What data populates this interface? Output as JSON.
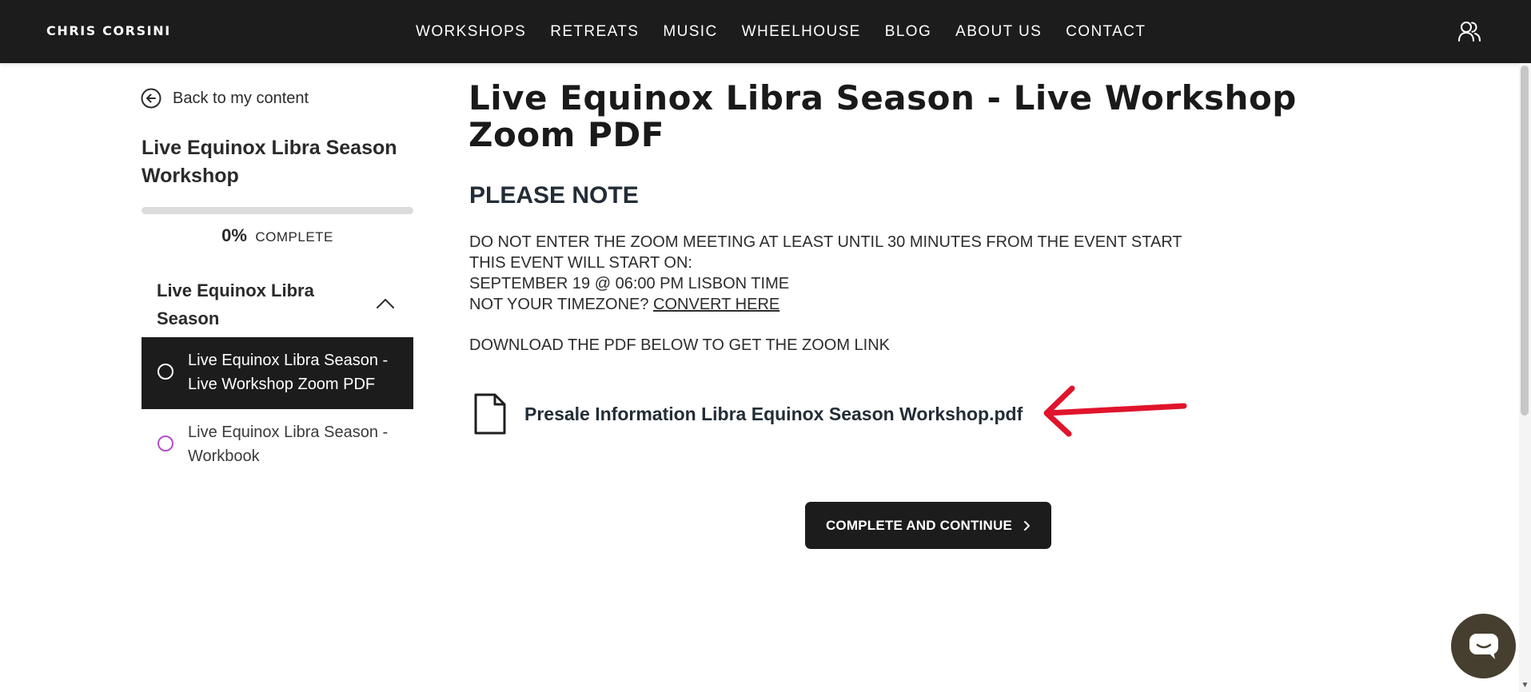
{
  "header": {
    "brand": "CHRIS CORSINI",
    "nav": [
      "WORKSHOPS",
      "RETREATS",
      "MUSIC",
      "WHEELHOUSE",
      "BLOG",
      "ABOUT US",
      "CONTACT"
    ],
    "account_icon": "user-group-icon"
  },
  "sidebar": {
    "back_label": "Back to my content",
    "course_title": "Live Equinox Libra Season Workshop",
    "progress": {
      "percent": 0,
      "percent_label": "0%",
      "label": "COMPLETE"
    },
    "section": {
      "title": "Live Equinox Libra Season",
      "expanded": true
    },
    "lessons": [
      {
        "label": "Live Equinox Libra Season - Live Workshop Zoom PDF",
        "active": true
      },
      {
        "label": "Live Equinox Libra Season - Workbook",
        "active": false
      }
    ]
  },
  "main": {
    "title": "Live Equinox Libra Season - Live Workshop Zoom PDF",
    "note_heading": "PLEASE NOTE",
    "note_lines": [
      "DO NOT ENTER THE ZOOM MEETING AT LEAST UNTIL 30 MINUTES FROM THE EVENT START",
      "THIS EVENT WILL START ON:",
      "SEPTEMBER 19 @ 06:00 PM LISBON TIME"
    ],
    "timezone_prefix": "NOT YOUR TIMEZONE? ",
    "timezone_link": "CONVERT HERE",
    "download_note": "DOWNLOAD THE PDF BELOW TO GET THE ZOOM LINK",
    "file_name": "Presale Information Libra Equinox Season Workshop.pdf",
    "button_label": "COMPLETE AND CONTINUE"
  },
  "colors": {
    "header_bg": "#1c1c1c",
    "accent_red": "#e0142c",
    "inactive_lesson_circle": "#b24fc9",
    "chat_bubble": "#463f2f"
  }
}
